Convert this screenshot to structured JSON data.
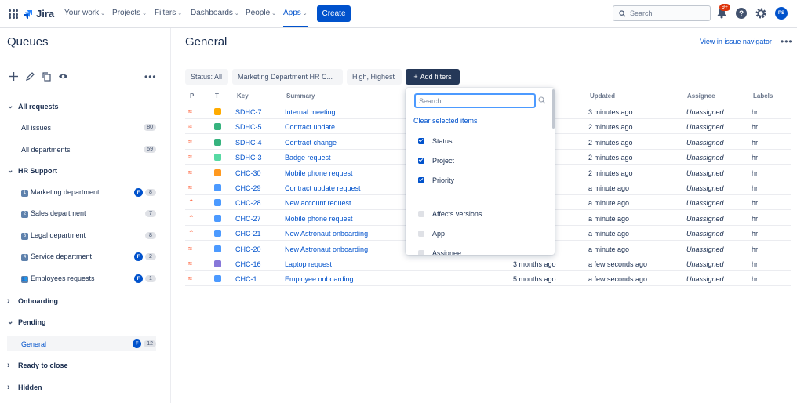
{
  "nav": {
    "logo": "Jira",
    "items": [
      {
        "label": "Your work",
        "chevron": true
      },
      {
        "label": "Projects",
        "chevron": true
      },
      {
        "label": "Filters",
        "chevron": true
      },
      {
        "label": "Dashboards",
        "chevron": true
      },
      {
        "label": "People",
        "chevron": true
      },
      {
        "label": "Apps",
        "chevron": true
      }
    ],
    "create_label": "Create",
    "search_placeholder": "Search",
    "notification_badge": "9+",
    "avatar_initials": "PS"
  },
  "sidebar": {
    "title": "Queues",
    "rows": [
      {
        "type": "group",
        "label": "All requests",
        "expanded": true
      },
      {
        "type": "item",
        "label": "All issues",
        "count": "80"
      },
      {
        "type": "item",
        "label": "All departments",
        "count": "59"
      },
      {
        "type": "group",
        "label": "HR Support",
        "expanded": true
      },
      {
        "type": "item",
        "label": "Marketing department",
        "icon": "1",
        "flag": "F",
        "count": "8"
      },
      {
        "type": "item",
        "label": "Sales department",
        "icon": "2",
        "count": "7"
      },
      {
        "type": "item",
        "label": "Legal department",
        "icon": "3",
        "count": "8"
      },
      {
        "type": "item",
        "label": "Service department",
        "icon": "4",
        "flag": "F",
        "count": "2"
      },
      {
        "type": "item",
        "label": "Employees requests",
        "icon": "👥",
        "flag": "F",
        "count": "1"
      },
      {
        "type": "group",
        "label": "Onboarding",
        "expanded": false
      },
      {
        "type": "group",
        "label": "Pending",
        "expanded": true
      },
      {
        "type": "item",
        "label": "General",
        "flag": "F",
        "count": "12",
        "selected": true
      },
      {
        "type": "group",
        "label": "Ready to close",
        "expanded": false
      },
      {
        "type": "group",
        "label": "Hidden",
        "expanded": false,
        "plain": true
      }
    ]
  },
  "main": {
    "title": "General",
    "view_in_navigator": "View in issue navigator",
    "filters": [
      {
        "label": "Status: All"
      },
      {
        "label": "Marketing Department HR C..."
      },
      {
        "label": "High, Highest"
      }
    ],
    "add_filters": "Add filters",
    "columns": {
      "p": "P",
      "t": "T",
      "key": "Key",
      "summary": "Summary",
      "updated": "Updated",
      "assignee": "Assignee",
      "labels": "Labels"
    },
    "rows": [
      {
        "prio": "highest",
        "type": "orange",
        "key": "SDHC-7",
        "summary": "Internal meeting",
        "created": "",
        "updated": "3 minutes ago",
        "assignee": "Unassigned",
        "labels": "hr"
      },
      {
        "prio": "highest",
        "type": "green",
        "key": "SDHC-5",
        "summary": "Contract update",
        "created": "",
        "updated": "2 minutes ago",
        "assignee": "Unassigned",
        "labels": "hr"
      },
      {
        "prio": "highest",
        "type": "green",
        "key": "SDHC-4",
        "summary": "Contract change",
        "created": "",
        "updated": "2 minutes ago",
        "assignee": "Unassigned",
        "labels": "hr"
      },
      {
        "prio": "highest",
        "type": "lime",
        "key": "SDHC-3",
        "summary": "Badge request",
        "created": "",
        "updated": "2 minutes ago",
        "assignee": "Unassigned",
        "labels": "hr"
      },
      {
        "prio": "highest",
        "type": "amber",
        "key": "CHC-30",
        "summary": "Mobile phone request",
        "created": "",
        "updated": "2 minutes ago",
        "assignee": "Unassigned",
        "labels": "hr"
      },
      {
        "prio": "highest",
        "type": "blue",
        "key": "CHC-29",
        "summary": "Contract update request",
        "created": "",
        "updated": "a minute ago",
        "assignee": "Unassigned",
        "labels": "hr"
      },
      {
        "prio": "high",
        "type": "blue",
        "key": "CHC-28",
        "summary": "New account request",
        "created": "",
        "updated": "a minute ago",
        "assignee": "Unassigned",
        "labels": "hr"
      },
      {
        "prio": "high",
        "type": "blue",
        "key": "CHC-27",
        "summary": "Mobile phone request",
        "created": "",
        "updated": "a minute ago",
        "assignee": "Unassigned",
        "labels": "hr"
      },
      {
        "prio": "high",
        "type": "blue",
        "key": "CHC-21",
        "summary": "New Astronaut onboarding",
        "created": "",
        "updated": "a minute ago",
        "assignee": "Unassigned",
        "labels": "hr"
      },
      {
        "prio": "highest",
        "type": "blue",
        "key": "CHC-20",
        "summary": "New Astronaut onboarding",
        "created": "",
        "updated": "a minute ago",
        "assignee": "Unassigned",
        "labels": "hr"
      },
      {
        "prio": "highest",
        "type": "purple",
        "key": "CHC-16",
        "summary": "Laptop request",
        "created": "3 months ago",
        "updated": "a few seconds ago",
        "assignee": "Unassigned",
        "labels": "hr"
      },
      {
        "prio": "highest",
        "type": "blue",
        "key": "CHC-1",
        "summary": "Employee onboarding",
        "created": "5 months ago",
        "updated": "a few seconds ago",
        "assignee": "Unassigned",
        "labels": "hr"
      }
    ]
  },
  "dropdown": {
    "search_placeholder": "Search",
    "clear": "Clear selected items",
    "options": [
      {
        "label": "Status",
        "checked": true
      },
      {
        "label": "Project",
        "checked": true
      },
      {
        "label": "Priority",
        "checked": true
      },
      {
        "label": "Affects versions",
        "checked": false
      },
      {
        "label": "App",
        "checked": false
      },
      {
        "label": "Assignee",
        "checked": false
      }
    ]
  },
  "colors": {
    "accent": "#0052cc",
    "create": "#0052cc",
    "add_filters_bg": "#253858",
    "priority": "#ff7452",
    "type_orange": "#ffab00",
    "type_green": "#36b37e",
    "type_lime": "#57d9a3",
    "type_amber": "#ff991f",
    "type_blue": "#4c9aff",
    "type_purple": "#8777d9"
  }
}
